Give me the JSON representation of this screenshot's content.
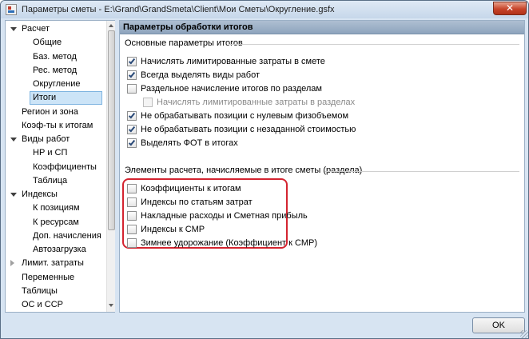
{
  "window": {
    "title": "Параметры сметы - E:\\Grand\\GrandSmeta\\Client\\Мои Сметы\\Округление.gsfx",
    "close_label": "✕",
    "close_icon": "close-icon",
    "app_icon": "app-icon"
  },
  "tree": {
    "items": [
      {
        "label": "Расчет",
        "expand": "down"
      },
      {
        "label": "Общие"
      },
      {
        "label": "Баз. метод"
      },
      {
        "label": "Рес. метод"
      },
      {
        "label": "Округление"
      },
      {
        "label": "Итоги",
        "selected": true
      },
      {
        "label": "Регион и зона"
      },
      {
        "label": "Коэф-ты к итогам"
      },
      {
        "label": "Виды работ",
        "expand": "down"
      },
      {
        "label": "НР и СП"
      },
      {
        "label": "Коэффициенты"
      },
      {
        "label": "Таблица"
      },
      {
        "label": "Индексы",
        "expand": "down"
      },
      {
        "label": "К позициям"
      },
      {
        "label": "К ресурсам"
      },
      {
        "label": "Доп. начисления"
      },
      {
        "label": "Автозагрузка"
      },
      {
        "label": "Лимит. затраты",
        "expand": "right"
      },
      {
        "label": "Переменные"
      },
      {
        "label": "Таблицы"
      },
      {
        "label": "ОС и ССР"
      }
    ]
  },
  "content": {
    "header": "Параметры обработки итогов",
    "group1_title": "Основные параметры итогов",
    "group1": [
      {
        "label": "Начислять лимитированные затраты в смете",
        "checked": true
      },
      {
        "label": "Всегда выделять виды работ",
        "checked": true
      },
      {
        "label": "Раздельное начисление итогов по разделам",
        "checked": false
      },
      {
        "label": "Начислять лимитированные затраты в разделах",
        "checked": false,
        "disabled": true
      },
      {
        "label": "Не обрабатывать позиции с нулевым физобъемом",
        "checked": true
      },
      {
        "label": "Не обрабатывать позиции с незаданной стоимостью",
        "checked": true
      },
      {
        "label": "Выделять ФОТ в итогах",
        "checked": true
      }
    ],
    "group2_title": "Элементы расчета, начисляемые в итоге сметы (раздела)",
    "group2": [
      {
        "label": "Коэффициенты к итогам",
        "checked": false
      },
      {
        "label": "Индексы по статьям затрат",
        "checked": false
      },
      {
        "label": "Накладные расходы и Сметная прибыль",
        "checked": false
      },
      {
        "label": "Индексы к СМР",
        "checked": false
      },
      {
        "label": "Зимнее удорожание (Коэффициент к СМР)",
        "checked": false
      }
    ],
    "highlight_color": "#d42430"
  },
  "footer": {
    "ok_label": "OK"
  }
}
